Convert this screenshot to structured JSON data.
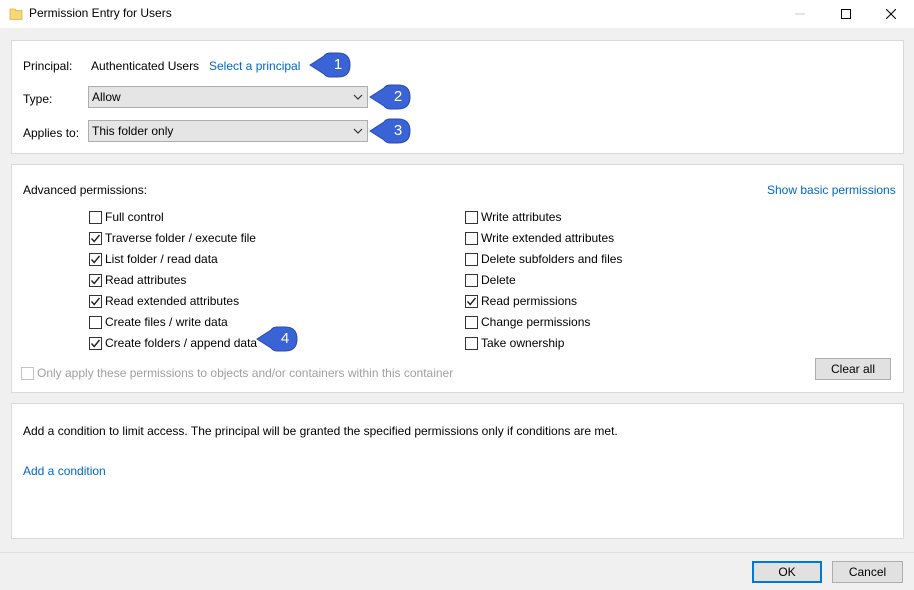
{
  "window": {
    "title": "Permission Entry for Users"
  },
  "principal": {
    "label": "Principal:",
    "value": "Authenticated Users",
    "select_link": "Select a principal"
  },
  "type": {
    "label": "Type:",
    "value": "Allow"
  },
  "applies_to": {
    "label": "Applies to:",
    "value": "This folder only"
  },
  "advanced": {
    "heading": "Advanced permissions:",
    "show_basic_link": "Show basic permissions",
    "left": [
      {
        "label": "Full control",
        "checked": false
      },
      {
        "label": "Traverse folder / execute file",
        "checked": true
      },
      {
        "label": "List folder / read data",
        "checked": true
      },
      {
        "label": "Read attributes",
        "checked": true
      },
      {
        "label": "Read extended attributes",
        "checked": true
      },
      {
        "label": "Create files / write data",
        "checked": false
      },
      {
        "label": "Create folders / append data",
        "checked": true
      }
    ],
    "right": [
      {
        "label": "Write attributes",
        "checked": false
      },
      {
        "label": "Write extended attributes",
        "checked": false
      },
      {
        "label": "Delete subfolders and files",
        "checked": false
      },
      {
        "label": "Delete",
        "checked": false
      },
      {
        "label": "Read permissions",
        "checked": true
      },
      {
        "label": "Change permissions",
        "checked": false
      },
      {
        "label": "Take ownership",
        "checked": false
      }
    ],
    "only_apply_label": "Only apply these permissions to objects and/or containers within this container",
    "clear_all_label": "Clear all"
  },
  "condition": {
    "description": "Add a condition to limit access. The principal will be granted the specified permissions only if conditions are met.",
    "add_link": "Add a condition"
  },
  "footer": {
    "ok_label": "OK",
    "cancel_label": "Cancel"
  },
  "callouts": [
    "1",
    "2",
    "3",
    "4"
  ],
  "colors": {
    "link": "#0066cc",
    "callout": "#3a63d6",
    "default_button_border": "#0078d7"
  }
}
